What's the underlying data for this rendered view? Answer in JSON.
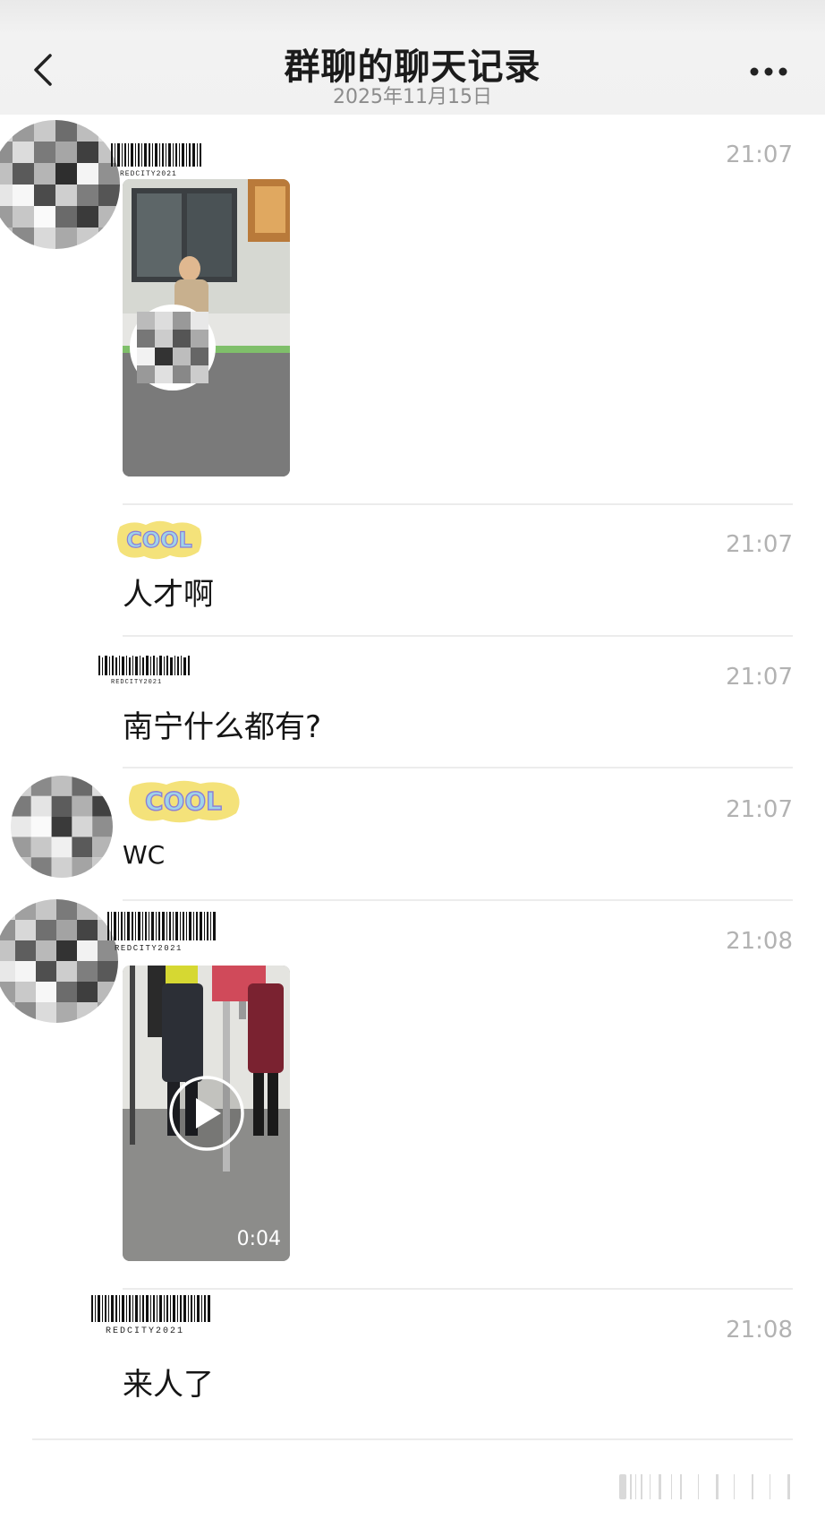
{
  "header": {
    "title": "群聊的聊天记录",
    "date": "2025年11月15日"
  },
  "messages": [
    {
      "type": "image",
      "time": "21:07"
    },
    {
      "type": "text",
      "time": "21:07",
      "text": "人才啊"
    },
    {
      "type": "text",
      "time": "21:07",
      "text": "南宁什么都有?"
    },
    {
      "type": "text",
      "time": "21:07",
      "text": "WC"
    },
    {
      "type": "video",
      "time": "21:08",
      "duration": "0:04"
    },
    {
      "type": "text",
      "time": "21:08",
      "text": "来人了"
    }
  ],
  "sticker_text": "COOL",
  "barcode_text": "REDCITY2021",
  "colors": {
    "header_bg": "#f1f1f1",
    "time": "#b2b2b2",
    "divider": "#ececec"
  },
  "icons": [
    "back-chevron-icon",
    "more-dots-icon",
    "play-icon"
  ]
}
